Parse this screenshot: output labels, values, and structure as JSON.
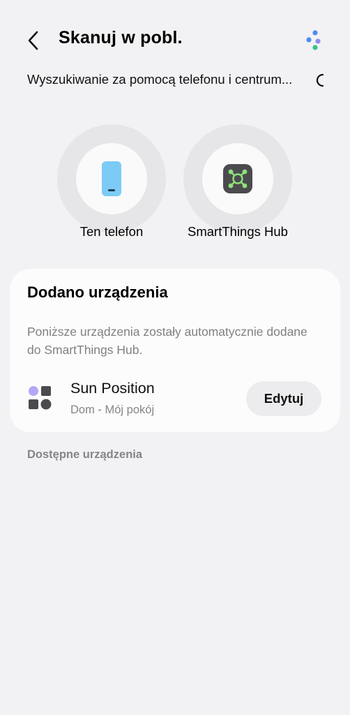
{
  "header": {
    "title": "Skanuj w pobl.",
    "back_icon": "chevron-left-icon",
    "more_icon": "more-options-dots-icon"
  },
  "scan": {
    "status_text": "Wyszukiwanie za pomocą telefonu i centrum..."
  },
  "sources": [
    {
      "label": "Ten telefon",
      "icon": "phone-icon",
      "color": "#7ccbf6"
    },
    {
      "label": "SmartThings Hub",
      "icon": "smartthings-hub-icon",
      "color": "#4b4b4f",
      "accent": "#8fe07a"
    }
  ],
  "added_card": {
    "title": "Dodano urządzenia",
    "description": "Poniższe urządzenia zostały automatycznie dodane do SmartThings Hub.",
    "devices": [
      {
        "name": "Sun Position",
        "room": "Dom - Mój pokój",
        "icon": "device-shapes-icon",
        "edit_label": "Edytuj"
      }
    ]
  },
  "available_section": {
    "title": "Dostępne urządzenia"
  },
  "colors": {
    "background": "#f2f2f4",
    "card": "#fcfcfc",
    "muted_text": "#85858a"
  }
}
